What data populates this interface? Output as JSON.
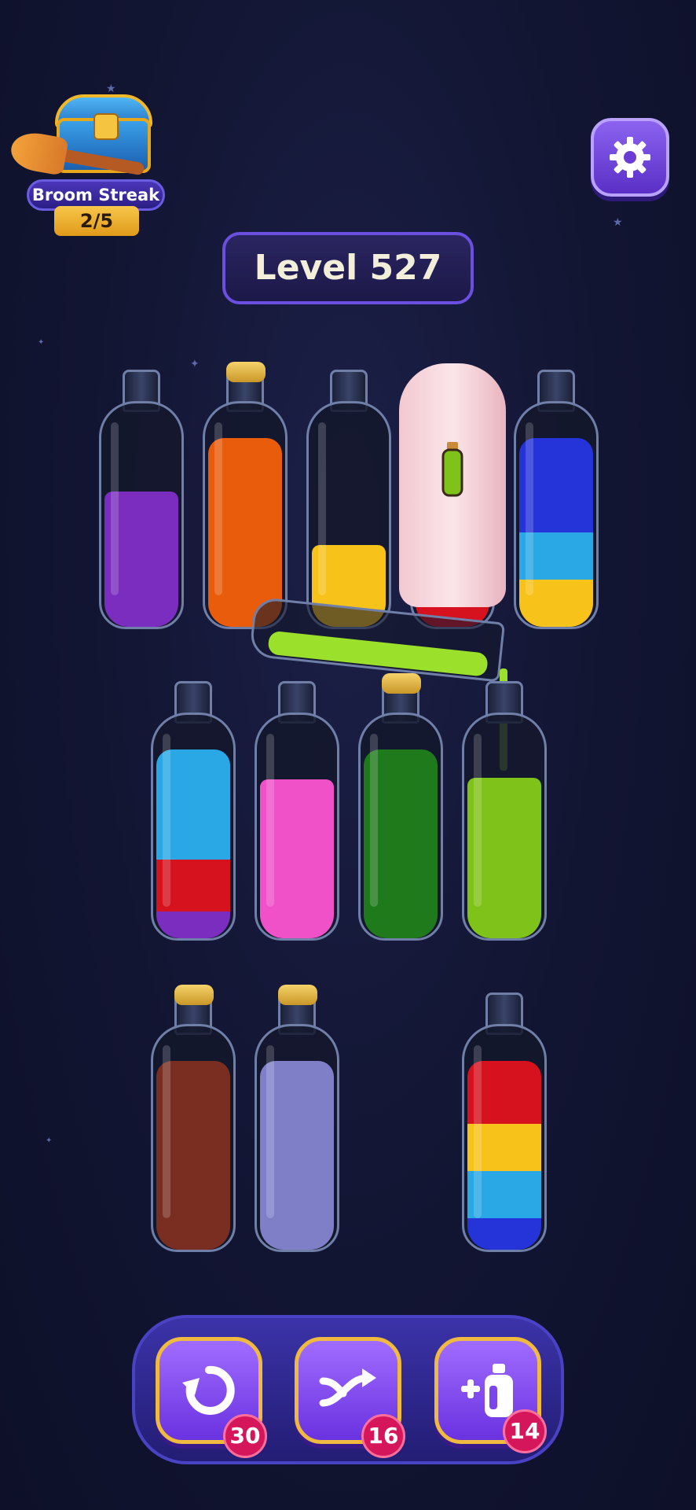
{
  "streak": {
    "label": "Broom Streak",
    "count": "2/5"
  },
  "level": {
    "label": "Level 527"
  },
  "tools": [
    {
      "name": "undo",
      "count": "30"
    },
    {
      "name": "shuffle",
      "count": "16"
    },
    {
      "name": "add-bottle",
      "count": "14"
    }
  ],
  "colors": {
    "purple": "#7a2dbf",
    "orange": "#e85c0c",
    "yellow": "#f7c21a",
    "blue": "#2434d8",
    "cyan": "#2aa8e6",
    "red": "#d5121e",
    "pink": "#f050c8",
    "dark_green": "#1f7a1c",
    "lime": "#7fc21a",
    "brown": "#7a2e22",
    "lavender": "#7f7fc8"
  }
}
